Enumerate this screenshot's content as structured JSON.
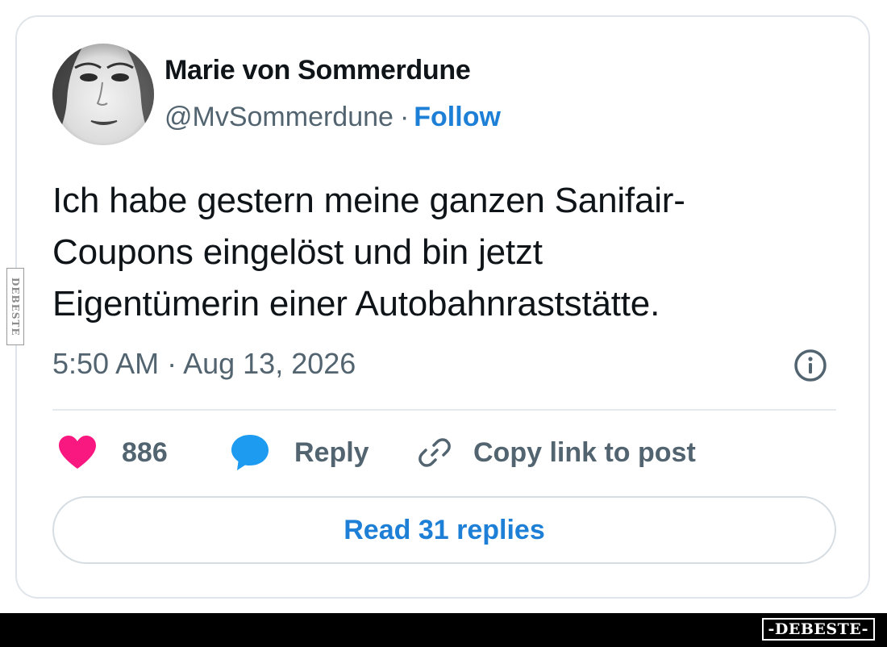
{
  "author": {
    "display_name": "Marie von Sommerdune",
    "handle": "@MvSommerdune",
    "separator": "·",
    "follow_label": "Follow",
    "avatar_icon": "avatar-portrait-icon"
  },
  "tweet": {
    "text_lines": [
      "Ich habe gestern meine ganzen Sanifair-",
      "Coupons eingelöst und bin jetzt",
      "Eigentümerin einer Autobahnraststätte."
    ],
    "timestamp": "5:50 AM · Aug 13, 2026",
    "info_icon": "info-icon"
  },
  "actions": {
    "like": {
      "icon": "heart-icon",
      "count": "886"
    },
    "reply": {
      "icon": "speech-bubble-icon",
      "label": "Reply"
    },
    "copy_link": {
      "icon": "link-icon",
      "label": "Copy link to post"
    }
  },
  "read_replies": {
    "label": "Read 31 replies"
  },
  "watermark": {
    "side_text": "DEBESTE",
    "logo_text": "-DEBESTE-"
  },
  "colors": {
    "link_blue": "#1d7fd6",
    "heart_pink": "#f91880",
    "reply_blue": "#1d9bf0",
    "text_primary": "#0f1419",
    "text_secondary": "#536471",
    "border": "#dfe5ea"
  }
}
